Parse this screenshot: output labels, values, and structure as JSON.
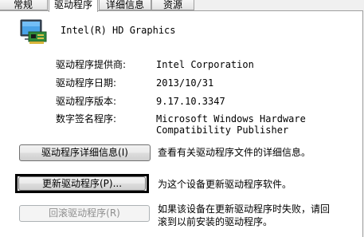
{
  "tabs": [
    "常规",
    "驱动程序",
    "详细信息",
    "资源"
  ],
  "active_tab_index": 1,
  "device": {
    "name": "Intel(R) HD Graphics",
    "icon": "display-adapter-icon"
  },
  "fields": [
    {
      "label": "驱动程序提供商:",
      "value": "Intel Corporation"
    },
    {
      "label": "驱动程序日期:",
      "value": "2013/10/31"
    },
    {
      "label": "驱动程序版本:",
      "value": "9.17.10.3347"
    },
    {
      "label": "数字签名程序:",
      "value": "Microsoft Windows Hardware\nCompatibility Publisher"
    }
  ],
  "actions": [
    {
      "label": "驱动程序详细信息(I)",
      "description": "查看有关驱动程序文件的详细信息。",
      "enabled": true
    },
    {
      "label": "更新驱动程序(P)...",
      "description": "为这个设备更新驱动程序软件。",
      "enabled": true,
      "focused": true
    },
    {
      "label": "回滚驱动程序(R)",
      "description": "如果该设备在更新驱动程序时失败，请回\n滚到以前安装的驱动程序。",
      "enabled": false
    }
  ]
}
